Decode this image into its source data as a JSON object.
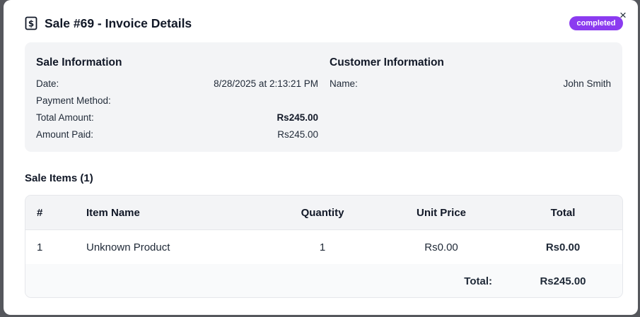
{
  "header": {
    "title": "Sale #69 - Invoice Details",
    "status": "completed",
    "close": "×"
  },
  "sale_info": {
    "title": "Sale Information",
    "rows": [
      {
        "label": "Date:",
        "value": "8/28/2025 at 2:13:21 PM"
      },
      {
        "label": "Payment Method:",
        "value": ""
      },
      {
        "label": "Total Amount:",
        "value": "Rs245.00"
      },
      {
        "label": "Amount Paid:",
        "value": "Rs245.00"
      }
    ]
  },
  "customer_info": {
    "title": "Customer Information",
    "rows": [
      {
        "label": "Name:",
        "value": "John Smith"
      }
    ]
  },
  "items": {
    "title": "Sale Items (1)",
    "columns": [
      "#",
      "Item Name",
      "Quantity",
      "Unit Price",
      "Total"
    ],
    "rows": [
      {
        "num": "1",
        "name": "Unknown Product",
        "qty": "1",
        "unit_price": "Rs0.00",
        "total": "Rs0.00"
      }
    ],
    "footer": {
      "label": "Total:",
      "value": "Rs245.00"
    }
  },
  "colors": {
    "badge": "#8b3bf0",
    "card": "#f3f4f6",
    "overlay": "#55575c"
  }
}
